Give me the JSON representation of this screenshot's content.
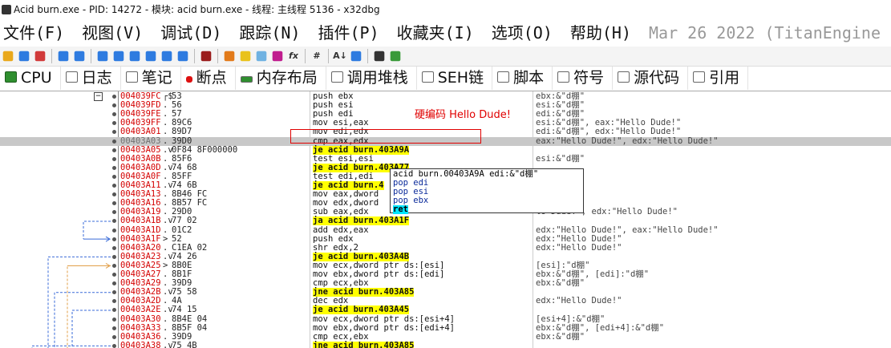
{
  "window": {
    "title": "Acid burn.exe - PID: 14272 - 模块: acid burn.exe - 线程: 主线程 5136 - x32dbg"
  },
  "menu": {
    "items": [
      "文件(F)",
      "视图(V)",
      "调试(D)",
      "跟踪(N)",
      "插件(P)",
      "收藏夹(I)",
      "选项(O)",
      "帮助(H)"
    ],
    "date": "Mar 26 2022 (TitanEngine"
  },
  "toolbar": {
    "icons": [
      {
        "name": "open-icon",
        "color": "#e9a81b"
      },
      {
        "name": "restart-icon",
        "color": "#2e7be0"
      },
      {
        "name": "close-icon",
        "color": "#d13a3a"
      },
      {
        "name": "run-icon",
        "color": "#2e7be0"
      },
      {
        "name": "pause-icon",
        "color": "#2e7be0"
      },
      {
        "name": "step-into-icon",
        "color": "#2e7be0"
      },
      {
        "name": "step-over-icon",
        "color": "#2e7be0"
      },
      {
        "name": "trace-into-icon",
        "color": "#2e7be0"
      },
      {
        "name": "trace-over-icon",
        "color": "#2e7be0"
      },
      {
        "name": "execute-till-return-icon",
        "color": "#2e7be0"
      },
      {
        "name": "run-to-user-code-icon",
        "color": "#2e7be0"
      },
      {
        "name": "scylla-icon",
        "color": "#9a1c1c"
      },
      {
        "name": "patch-icon",
        "color": "#e27a1a"
      },
      {
        "name": "comment-icon",
        "color": "#e9c21b"
      },
      {
        "name": "label-icon",
        "color": "#6fb2e2"
      },
      {
        "name": "bookmark-icon",
        "color": "#c01c8e"
      },
      {
        "name": "function-icon",
        "color": "#333333"
      },
      {
        "name": "hash-icon",
        "color": "#333333"
      },
      {
        "name": "font-icon",
        "color": "#333333"
      },
      {
        "name": "calc-icon",
        "color": "#2e7be0"
      },
      {
        "name": "notes-icon",
        "color": "#333333"
      },
      {
        "name": "globe-icon",
        "color": "#3a9a3a"
      }
    ],
    "glyphs": {
      "function": "fx",
      "hash": "#",
      "font": "A↓"
    }
  },
  "tabs": [
    {
      "label": "CPU",
      "icon": "cpu-icon",
      "active": true
    },
    {
      "label": "日志",
      "icon": "log-icon"
    },
    {
      "label": "笔记",
      "icon": "notes-icon"
    },
    {
      "label": "断点",
      "icon": "breakpoint-icon"
    },
    {
      "label": "内存布局",
      "icon": "memory-map-icon"
    },
    {
      "label": "调用堆栈",
      "icon": "call-stack-icon"
    },
    {
      "label": "SEH链",
      "icon": "seh-icon"
    },
    {
      "label": "脚本",
      "icon": "script-icon"
    },
    {
      "label": "符号",
      "icon": "symbol-icon"
    },
    {
      "label": "源代码",
      "icon": "source-icon"
    },
    {
      "label": "引用",
      "icon": "reference-icon"
    }
  ],
  "annotation": {
    "label": "硬编码 Hello Dude!"
  },
  "popup": {
    "lines": [
      "acid burn.00403A9A edi:&\"d棚\"",
      "pop edi",
      "pop esi",
      "pop ebx",
      "ret"
    ]
  },
  "disasm": {
    "highlight_index": 7,
    "collapse_glyph": "−",
    "rows": [
      {
        "addr": "004039FC",
        "mk": "┌$",
        "bytes": "53",
        "ins": "push ebx",
        "cmt": "ebx:&\"d棚\"",
        "red": true
      },
      {
        "addr": "004039FD",
        "mk": ".",
        "bytes": "56",
        "ins": "push esi",
        "cmt": "esi:&\"d棚\"",
        "red": true
      },
      {
        "addr": "004039FE",
        "mk": ".",
        "bytes": "57",
        "ins": "push edi",
        "cmt": "edi:&\"d棚\"",
        "red": true
      },
      {
        "addr": "004039FF",
        "mk": ".",
        "bytes": "89C6",
        "ins": "mov esi,eax",
        "cmt": "esi:&\"d棚\", eax:\"Hello Dude!\"",
        "red": true
      },
      {
        "addr": "00403A01",
        "mk": ".",
        "bytes": "89D7",
        "ins": "mov edi,edx",
        "cmt": "edi:&\"d棚\", edx:\"Hello Dude!\"",
        "red": true
      },
      {
        "addr": "00403A03",
        "mk": ".",
        "bytes": "39D0",
        "ins": "cmp eax,edx",
        "cmt": "eax:\"Hello Dude!\", edx:\"Hello Dude!\"",
        "red": false
      },
      {
        "addr": "00403A05",
        "mk": ".v",
        "bytes": "0F84 8F000000",
        "ins": "je acid burn.403A9A",
        "cmt": "",
        "red": true,
        "jmp": true
      },
      {
        "addr": "00403A0B",
        "mk": ".",
        "bytes": "85F6",
        "ins": "test esi,esi",
        "cmt": "esi:&\"d棚\"",
        "red": true
      },
      {
        "addr": "00403A0D",
        "mk": ".v",
        "bytes": "74 68",
        "ins": "je acid burn.403A77",
        "cmt": "",
        "red": true,
        "jmp": true
      },
      {
        "addr": "00403A0F",
        "mk": ".",
        "bytes": "85FF",
        "ins": "test edi,edi",
        "cmt": "",
        "red": true
      },
      {
        "addr": "00403A11",
        "mk": ".v",
        "bytes": "74 6B",
        "ins": "je acid burn.4",
        "cmt": "",
        "red": true,
        "jmp": true
      },
      {
        "addr": "00403A13",
        "mk": ".",
        "bytes": "8B46 FC",
        "ins": "mov eax,dword",
        "cmt": "lo Dude!\"",
        "red": true
      },
      {
        "addr": "00403A16",
        "mk": ".",
        "bytes": "8B57 FC",
        "ins": "mov edx,dword",
        "cmt": "lo Dude!\"",
        "red": true
      },
      {
        "addr": "00403A19",
        "mk": ".",
        "bytes": "29D0",
        "ins": "sub eax,edx",
        "cmt": "lo Dude!\", edx:\"Hello Dude!\"",
        "red": true
      },
      {
        "addr": "00403A1B",
        "mk": ".v",
        "bytes": "77 02",
        "ins": "ja acid burn.403A1F",
        "cmt": "",
        "red": true,
        "jmp": true
      },
      {
        "addr": "00403A1D",
        "mk": ".",
        "bytes": "01C2",
        "ins": "add edx,eax",
        "cmt": "edx:\"Hello Dude!\", eax:\"Hello Dude!\"",
        "red": true
      },
      {
        "addr": "00403A1F",
        "mk": ">",
        "bytes": "52",
        "ins": "push edx",
        "cmt": "edx:\"Hello Dude!\"",
        "red": true
      },
      {
        "addr": "00403A20",
        "mk": ".",
        "bytes": "C1EA 02",
        "ins": "shr edx,2",
        "cmt": "edx:\"Hello Dude!\"",
        "red": true
      },
      {
        "addr": "00403A23",
        "mk": ".v",
        "bytes": "74 26",
        "ins": "je acid burn.403A4B",
        "cmt": "",
        "red": true,
        "jmp": true
      },
      {
        "addr": "00403A25",
        "mk": ">",
        "bytes": "8B0E",
        "ins": "mov ecx,dword ptr ds:[esi]",
        "cmt": "[esi]:\"d棚\"",
        "red": true
      },
      {
        "addr": "00403A27",
        "mk": ".",
        "bytes": "8B1F",
        "ins": "mov ebx,dword ptr ds:[edi]",
        "cmt": "ebx:&\"d棚\", [edi]:\"d棚\"",
        "red": true
      },
      {
        "addr": "00403A29",
        "mk": ".",
        "bytes": "39D9",
        "ins": "cmp ecx,ebx",
        "cmt": "ebx:&\"d棚\"",
        "red": true
      },
      {
        "addr": "00403A2B",
        "mk": ".v",
        "bytes": "75 58",
        "ins": "jne acid burn.403A85",
        "cmt": "",
        "red": true,
        "jmp": true
      },
      {
        "addr": "00403A2D",
        "mk": ".",
        "bytes": "4A",
        "ins": "dec edx",
        "cmt": "edx:\"Hello Dude!\"",
        "red": true
      },
      {
        "addr": "00403A2E",
        "mk": ".v",
        "bytes": "74 15",
        "ins": "je acid burn.403A45",
        "cmt": "",
        "red": true,
        "jmp": true
      },
      {
        "addr": "00403A30",
        "mk": ".",
        "bytes": "8B4E 04",
        "ins": "mov ecx,dword ptr ds:[esi+4]",
        "cmt": "[esi+4]:&\"d棚\"",
        "red": true
      },
      {
        "addr": "00403A33",
        "mk": ".",
        "bytes": "8B5F 04",
        "ins": "mov ebx,dword ptr ds:[edi+4]",
        "cmt": "ebx:&\"d棚\", [edi+4]:&\"d棚\"",
        "red": true
      },
      {
        "addr": "00403A36",
        "mk": ".",
        "bytes": "39D9",
        "ins": "cmp ecx,ebx",
        "cmt": "ebx:&\"d棚\"",
        "red": true
      },
      {
        "addr": "00403A38",
        "mk": ".v",
        "bytes": "75 4B",
        "ins": "jne acid burn.403A85",
        "cmt": "",
        "red": true,
        "jmp": true
      }
    ]
  }
}
